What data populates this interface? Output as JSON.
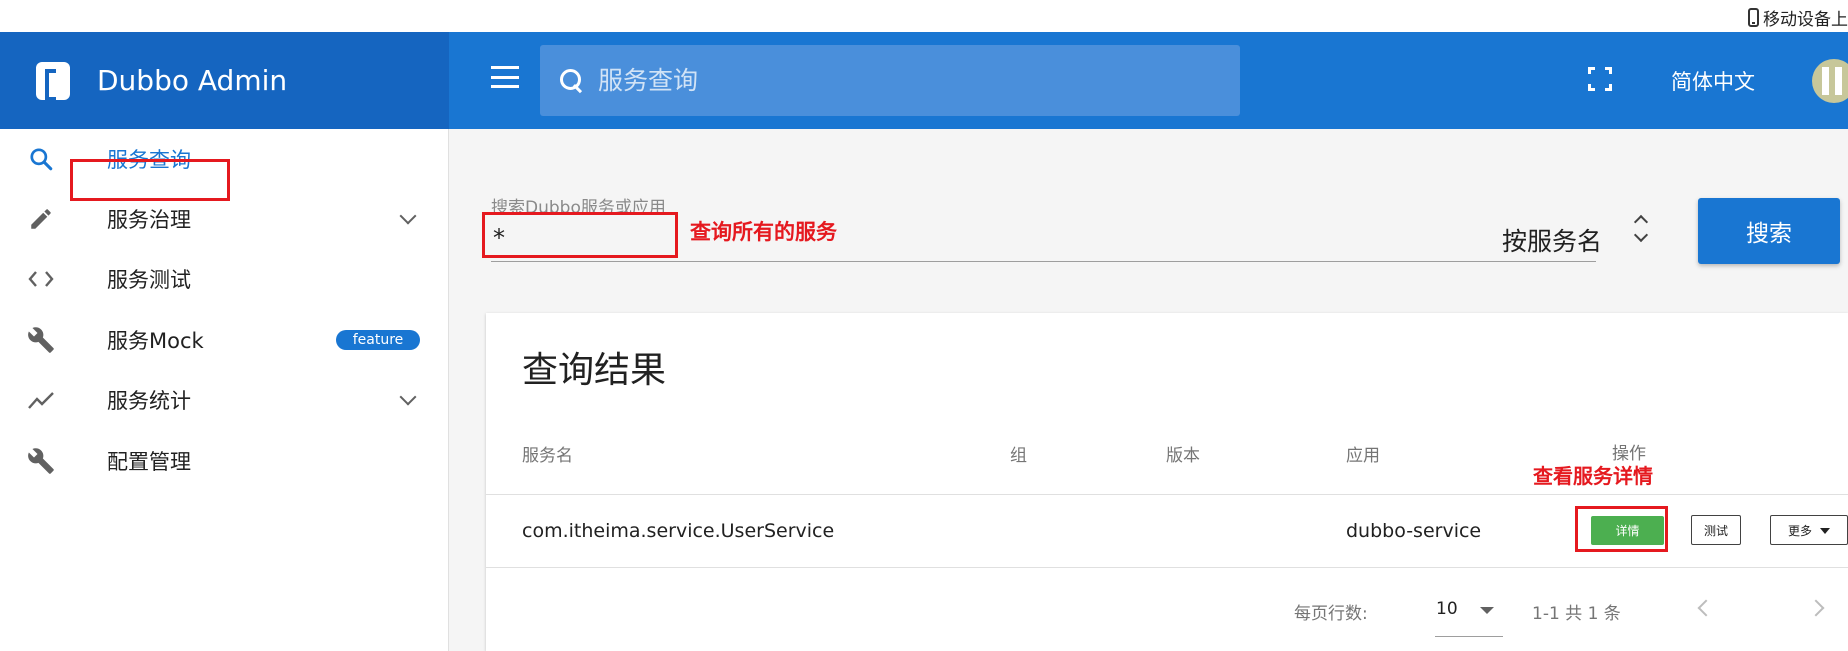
{
  "top_strip": {
    "mobile_hint": "移动设备上"
  },
  "header": {
    "brand": "Dubbo Admin",
    "search_placeholder": "服务查询",
    "language": "简体中文"
  },
  "sidebar": {
    "items": [
      {
        "label": "服务查询",
        "icon": "search-icon"
      },
      {
        "label": "服务治理",
        "icon": "pencil-icon"
      },
      {
        "label": "服务测试",
        "icon": "code-icon"
      },
      {
        "label": "服务Mock",
        "icon": "wrench-icon",
        "badge": "feature"
      },
      {
        "label": "服务统计",
        "icon": "trend-icon"
      },
      {
        "label": "配置管理",
        "icon": "wrench-icon"
      }
    ]
  },
  "search": {
    "label": "搜索Dubbo服务或应用",
    "value": "*",
    "mode": "按服务名",
    "button": "搜索"
  },
  "annotations": {
    "query_all": "查询所有的服务",
    "view_detail": "查看服务详情"
  },
  "results": {
    "title": "查询结果",
    "columns": [
      "服务名",
      "组",
      "版本",
      "应用",
      "操作"
    ],
    "rows": [
      {
        "service": "com.itheima.service.UserService",
        "group": "",
        "version": "",
        "app": "dubbo-service"
      }
    ],
    "actions": {
      "detail": "详情",
      "test": "测试",
      "more": "更多"
    },
    "footer": {
      "rows_per_page_label": "每页行数:",
      "rows_per_page": "10",
      "range": "1-1 共 1 条"
    }
  },
  "colors": {
    "brand_dark": "#1565c0",
    "app_bar": "#1976d2",
    "detail_button": "#4caf50",
    "annotation_red": "#e5191f"
  }
}
